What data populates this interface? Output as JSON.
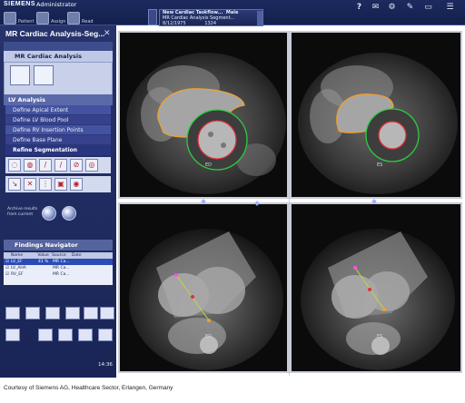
{
  "header": {
    "brand": "SIEMENS",
    "user": "Administrator",
    "buttons": [
      {
        "label": "Patient",
        "icon": "patient-browser-icon"
      },
      {
        "label": "Assign",
        "icon": "assign-icon"
      },
      {
        "label": "Read",
        "icon": "read-icon"
      }
    ],
    "task_card": {
      "title": "New Cardiac Taskflow...",
      "subtitle": "MR Cardiac Analysis Segment...",
      "date": "8/12/1975",
      "id": "1324",
      "sex": "Male"
    },
    "right_icons": [
      "help-icon",
      "mail-icon",
      "settings-icon",
      "tools-icon",
      "screen-icon",
      "menu-icon"
    ]
  },
  "left_panel": {
    "title": "MR Cardiac Analysis-Seg...",
    "module_header": "MR Cardiac Analysis",
    "section": "LV Analysis",
    "steps": [
      "Define Apical Extent",
      "Define LV Blood Pool",
      "Define RV Insertion Points",
      "Define Base Plane",
      "Refine Segmentation"
    ],
    "archive_text": [
      "Archive results",
      "from current"
    ],
    "findings": {
      "title": "Findings Navigator",
      "columns": [
        "Name",
        "Value",
        "Source",
        "Date"
      ],
      "rows": [
        {
          "name": "LV_EF",
          "value": "41 %",
          "source": "MR Ca...",
          "selected": true
        },
        {
          "name": "LV_AHA",
          "value": "",
          "source": "MR Ca...",
          "selected": false
        },
        {
          "name": "RV_EF",
          "value": "",
          "source": "MR Ca...",
          "selected": false
        }
      ]
    },
    "clock": "14:36"
  },
  "viewports": [
    {
      "id": "sax-1",
      "label": "ED"
    },
    {
      "id": "sax-2",
      "label": "ES"
    },
    {
      "id": "lax-1",
      "label": "ED"
    },
    {
      "id": "lax-2",
      "label": "ES"
    }
  ],
  "caption": "Courtesy of Siemens AG, Healthcare Sector, Erlangen, Germany",
  "colors": {
    "epicardium": "#2ecc40",
    "endocardium": "#e0303a",
    "rv_contour": "#f0a030",
    "panel": "#1f2b60"
  }
}
